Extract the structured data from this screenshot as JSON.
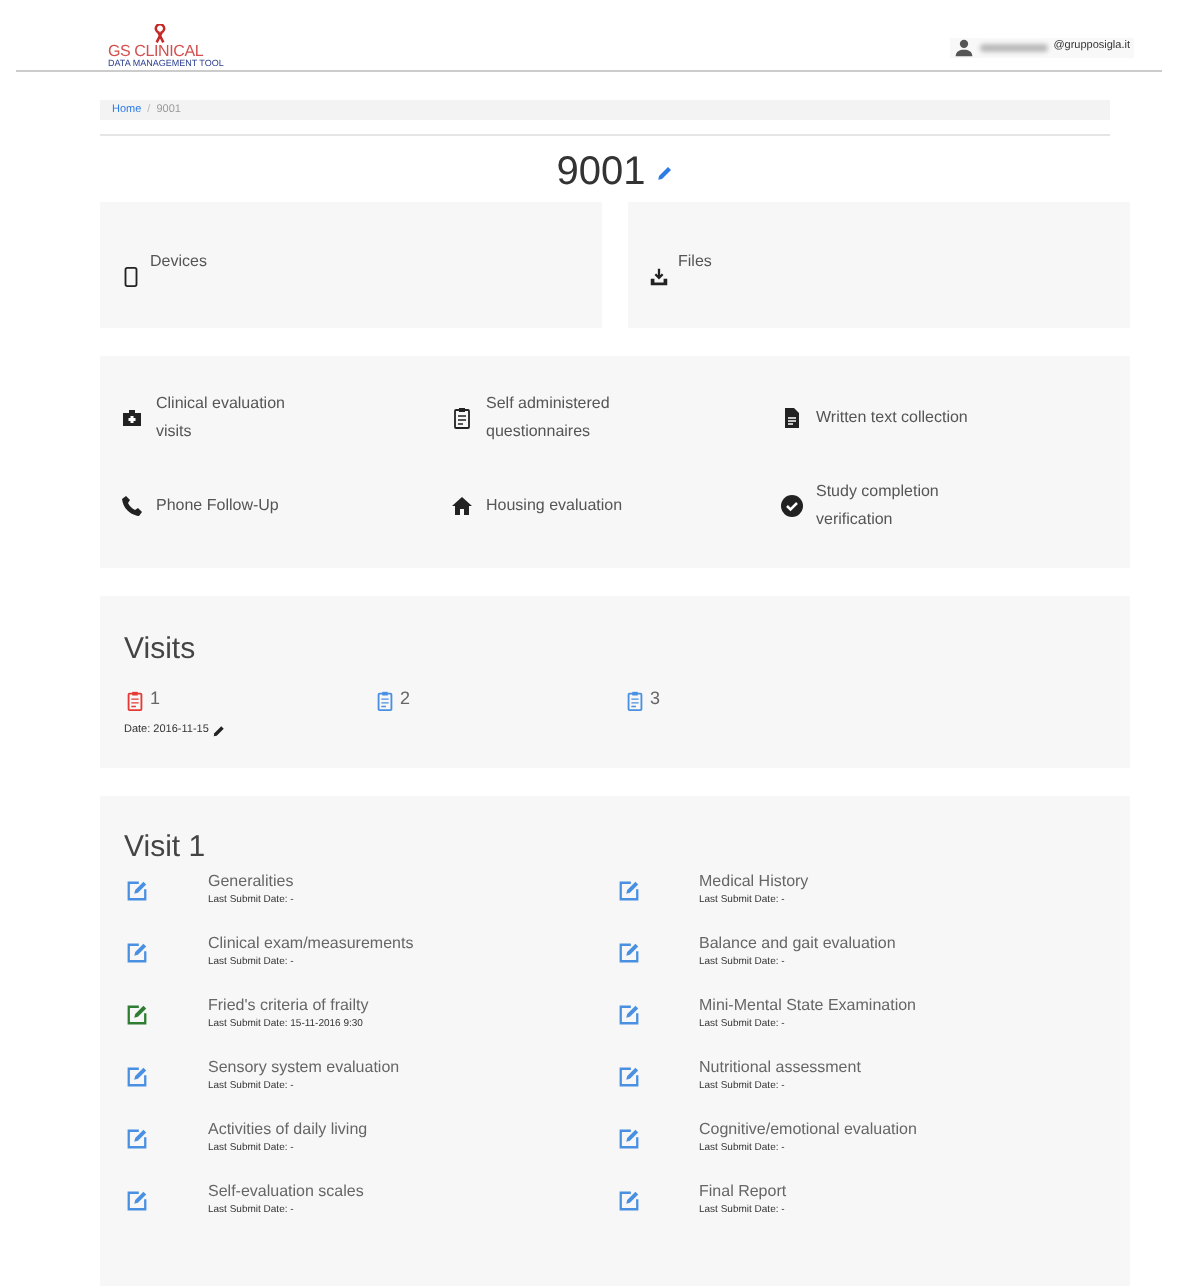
{
  "header": {
    "logo_title": "GS CLINICAL",
    "logo_subtitle": "DATA MANAGEMENT TOOL",
    "user_email": "@grupposigla.it"
  },
  "breadcrumb_separator": "/",
  "breadcrumb": [
    {
      "label": "Home",
      "kind": "link"
    },
    {
      "label": "9001",
      "kind": "current"
    }
  ],
  "patient_id": "9001",
  "top_cards": [
    {
      "label": "Devices",
      "kind": "device"
    },
    {
      "label": "Files",
      "kind": "download"
    }
  ],
  "sections": [
    {
      "label": "Clinical evaluation visits",
      "kind": "medkit"
    },
    {
      "label": "Self administered questionnaires",
      "kind": "clipboard"
    },
    {
      "label": "Written text collection",
      "kind": "document"
    },
    {
      "label": "Phone Follow-Up",
      "kind": "phone"
    },
    {
      "label": "Housing evaluation",
      "kind": "house"
    },
    {
      "label": "Study completion verification",
      "kind": "check"
    }
  ],
  "visits": {
    "title": "Visits",
    "items": [
      {
        "number": "1",
        "selected": true,
        "date": "Date: 2016-11-15"
      },
      {
        "number": "2",
        "selected": false
      },
      {
        "number": "3",
        "selected": false
      }
    ]
  },
  "visit_detail": {
    "title": "Visit 1",
    "forms": [
      {
        "name": "Generalities",
        "submitted": false,
        "last_submit": "Last Submit Date: -"
      },
      {
        "name": "Medical History",
        "submitted": false,
        "last_submit": "Last Submit Date: -"
      },
      {
        "name": "Clinical exam/measurements",
        "submitted": false,
        "last_submit": "Last Submit Date: -"
      },
      {
        "name": "Balance and gait evaluation",
        "submitted": false,
        "last_submit": "Last Submit Date: -"
      },
      {
        "name": "Fried's criteria of frailty",
        "submitted": true,
        "last_submit": "Last Submit Date: 15-11-2016 9:30"
      },
      {
        "name": "Mini-Mental State Examination",
        "submitted": false,
        "last_submit": "Last Submit Date: -"
      },
      {
        "name": "Sensory system evaluation",
        "submitted": false,
        "last_submit": "Last Submit Date: -"
      },
      {
        "name": "Nutritional assessment",
        "submitted": false,
        "last_submit": "Last Submit Date: -"
      },
      {
        "name": "Activities of daily living",
        "submitted": false,
        "last_submit": "Last Submit Date: -"
      },
      {
        "name": "Cognitive/emotional evaluation",
        "submitted": false,
        "last_submit": "Last Submit Date: -"
      },
      {
        "name": "Self-evaluation scales",
        "submitted": false,
        "last_submit": "Last Submit Date: -"
      },
      {
        "name": "Final Report",
        "submitted": false,
        "last_submit": "Last Submit Date: -"
      }
    ]
  }
}
